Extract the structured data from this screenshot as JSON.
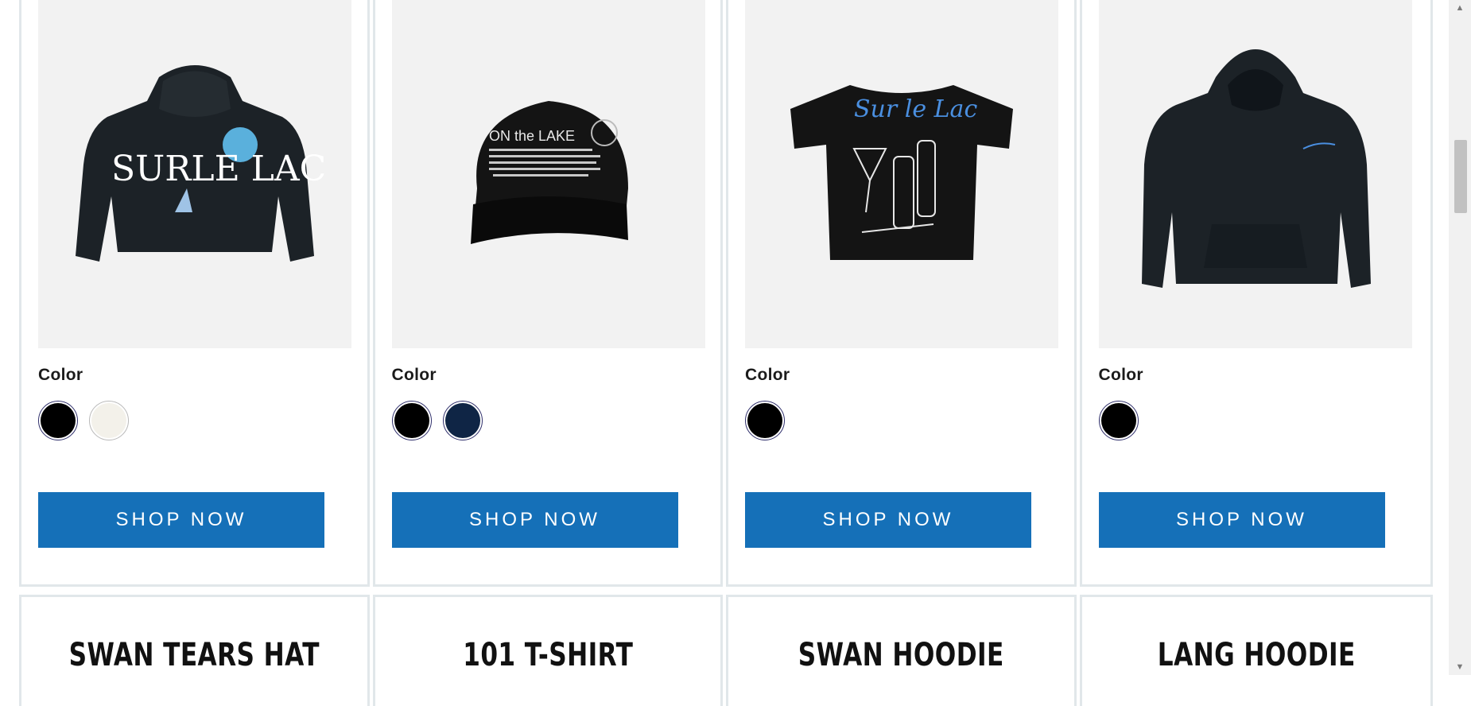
{
  "products": [
    {
      "color_label": "Color",
      "colors": [
        "#000000",
        "#f3f1ea"
      ],
      "button_label": "SHOP NOW",
      "image_text": "SURLE LAC",
      "icon": "hoodie-back-print-image"
    },
    {
      "color_label": "Color",
      "colors": [
        "#000000",
        "#0f2545"
      ],
      "button_label": "SHOP NOW",
      "image_text": "ON the LAKE",
      "icon": "trucker-hat-image"
    },
    {
      "color_label": "Color",
      "colors": [
        "#000000"
      ],
      "button_label": "SHOP NOW",
      "image_text": "Sur le Lac",
      "icon": "tshirt-bottles-image"
    },
    {
      "color_label": "Color",
      "colors": [
        "#000000"
      ],
      "button_label": "SHOP NOW",
      "image_text": "",
      "icon": "hoodie-front-image"
    }
  ],
  "next_row_titles": [
    "SWAN TEARS HAT",
    "101 T-SHIRT",
    "SWAN HOODIE",
    "LANG HOODIE"
  ],
  "colors": {
    "button": "#1570b8",
    "border": "#e1e7ea",
    "image_bg": "#f2f2f2"
  }
}
